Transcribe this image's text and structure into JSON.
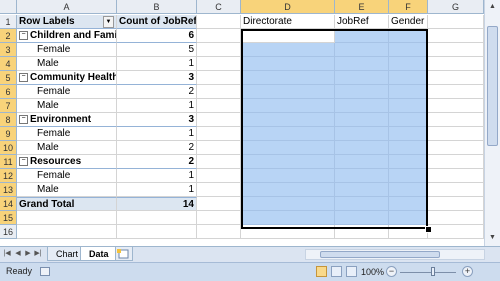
{
  "columns": [
    "A",
    "B",
    "C",
    "D",
    "E",
    "F",
    "G"
  ],
  "rows": [
    "1",
    "2",
    "3",
    "4",
    "5",
    "6",
    "7",
    "8",
    "9",
    "10",
    "11",
    "12",
    "13",
    "14",
    "15",
    "16"
  ],
  "pivot": {
    "header_label": "Row Labels",
    "header_value": "Count of JobRef",
    "rows": [
      {
        "label": "Children and Family",
        "value": "6",
        "level": 0
      },
      {
        "label": "Female",
        "value": "5",
        "level": 1
      },
      {
        "label": "Male",
        "value": "1",
        "level": 1
      },
      {
        "label": "Community Health",
        "value": "3",
        "level": 0
      },
      {
        "label": "Female",
        "value": "2",
        "level": 1
      },
      {
        "label": "Male",
        "value": "1",
        "level": 1
      },
      {
        "label": "Environment",
        "value": "3",
        "level": 0
      },
      {
        "label": "Female",
        "value": "1",
        "level": 1
      },
      {
        "label": "Male",
        "value": "2",
        "level": 1
      },
      {
        "label": "Resources",
        "value": "2",
        "level": 0
      },
      {
        "label": "Female",
        "value": "1",
        "level": 1
      },
      {
        "label": "Male",
        "value": "1",
        "level": 1
      }
    ],
    "grand_total_label": "Grand Total",
    "grand_total_value": "14"
  },
  "table_headers": {
    "d": "Directorate",
    "e": "JobRef",
    "f": "Gender"
  },
  "sheet_tabs": [
    {
      "label": "Chart",
      "active": false
    },
    {
      "label": "Data",
      "active": true
    }
  ],
  "status": {
    "ready": "Ready",
    "zoom": "100%"
  },
  "icons": {
    "collapse": "minus-box-icon",
    "filter": "dropdown-arrow-icon",
    "new_sheet": "new-sheet-icon",
    "macro": "macro-record-icon"
  },
  "colors": {
    "selection_fill": "#b8d4f5",
    "selected_header": "#f8d37a",
    "pivot_header": "#dce6f1"
  }
}
